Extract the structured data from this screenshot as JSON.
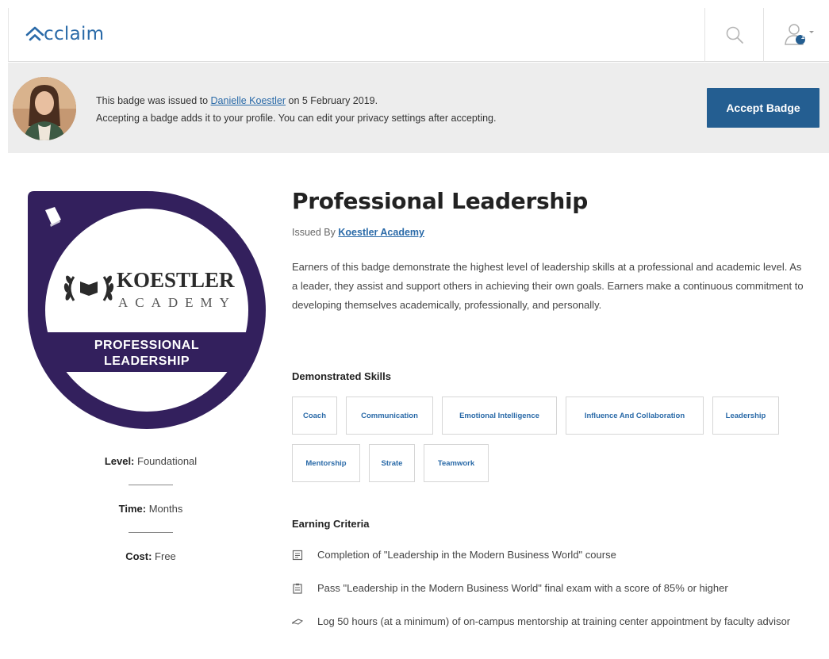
{
  "header": {
    "logo_text": "cclaim",
    "search_icon": "search-icon",
    "profile_icon": "user-icon",
    "notification_count": "1"
  },
  "banner": {
    "line1_prefix": "This badge was issued to ",
    "recipient": "Danielle Koestler",
    "line1_suffix": " on 5 February 2019.",
    "line2": "Accepting a badge adds it to your profile. You can edit your privacy settings after accepting.",
    "accept_label": "Accept Badge"
  },
  "badge": {
    "org_name": "KOESTLER",
    "org_sub": "ACADEMY",
    "ribbon_line1": "PROFESSIONAL",
    "ribbon_line2": "LEADERSHIP",
    "color_primary": "#33205d"
  },
  "meta": {
    "level_label": "Level:",
    "level_value": " Foundational",
    "time_label": "Time:",
    "time_value": " Months",
    "cost_label": "Cost:",
    "cost_value": " Free"
  },
  "details": {
    "title": "Professional Leadership",
    "issued_by_label": "Issued By ",
    "issuer": "Koestler Academy",
    "description": "Earners of this badge demonstrate the highest level of leadership skills at a professional and academic level. As a leader, they assist and support others in achieving their own goals. Earners make a continuous commitment to developing themselves academically, professionally, and personally."
  },
  "skills": {
    "heading": "Demonstrated Skills",
    "items": [
      "Coach",
      "Communication",
      "Emotional Intelligence",
      "Influence And Collaboration",
      "Leadership",
      "Mentorship",
      "Strate",
      "Teamwork"
    ]
  },
  "criteria": {
    "heading": "Earning Criteria",
    "items": [
      {
        "icon": "course-icon",
        "text": "Completion of \"Leadership in the Modern Business World\" course"
      },
      {
        "icon": "exam-icon",
        "text": "Pass \"Leadership in the Modern Business World\" final exam with a  score of 85% or higher"
      },
      {
        "icon": "experience-icon",
        "text": "Log 50 hours (at a minimum) of on-campus mentorship at training center appointment by faculty advisor"
      }
    ]
  },
  "colors": {
    "link": "#2a6aa8",
    "accept_button": "#245e91",
    "banner_bg": "#ededed",
    "badge_purple": "#33205d"
  }
}
